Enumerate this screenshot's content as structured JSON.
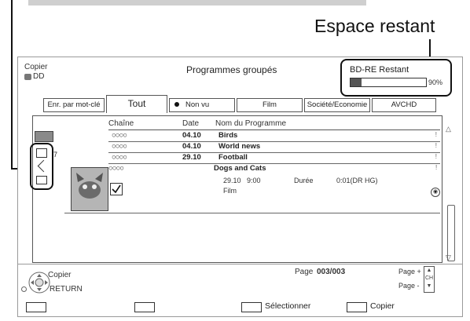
{
  "callout": {
    "title": "Espace restant"
  },
  "header": {
    "copy_label": "Copier",
    "device_label": "DD",
    "section_title": "Programmes groupés",
    "remaining_label": "BD-RE Restant",
    "remaining_percent": "90%",
    "remaining_fraction": 0.9
  },
  "tabs": [
    {
      "label": "Enr. par mot-clé"
    },
    {
      "label": "Tout"
    },
    {
      "label": "Non vu"
    },
    {
      "label": "Film"
    },
    {
      "label": "Société/Economie"
    },
    {
      "label": "AVCHD"
    }
  ],
  "list": {
    "columns": {
      "channel": "Chaîne",
      "date": "Date",
      "name": "Nom du Programme"
    },
    "rows": [
      {
        "channel": "○○○○",
        "date": "04.10",
        "name": "Birds"
      },
      {
        "channel": "○○○○",
        "date": "04.10",
        "name": "World news"
      },
      {
        "channel": "○○○○",
        "date": "29.10",
        "name": "Football"
      }
    ],
    "row_marker": "7",
    "group": {
      "channel": "○○○○",
      "title": "Dogs and Cats",
      "date": "29.10",
      "time": "9:00",
      "duration_label": "Durée",
      "duration": "0:01(DR HG)",
      "genre": "Film",
      "selected": true
    }
  },
  "footer": {
    "page_label": "Page",
    "page_value": "003/003",
    "page_plus": "Page +",
    "page_minus": "Page -",
    "nav_copy": "Copier",
    "nav_return": "RETURN",
    "select_label": "Sélectionner",
    "copy_label": "Copier"
  },
  "colors": {
    "accent": "#111111",
    "frame": "#9a9a9a",
    "thumb": "#8a8a8a"
  }
}
